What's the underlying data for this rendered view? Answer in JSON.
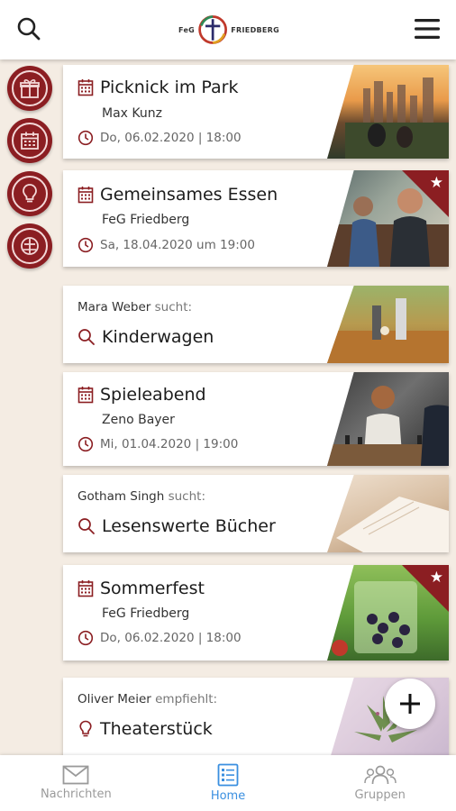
{
  "header": {
    "logo_left": "FeG",
    "logo_right": "FRIEDBERG",
    "search_icon": "search-icon",
    "menu_icon": "hamburger-menu-icon"
  },
  "sidebar": {
    "items": [
      {
        "icon": "gift-icon"
      },
      {
        "icon": "calendar-icon"
      },
      {
        "icon": "lightbulb-icon"
      },
      {
        "icon": "church-icon"
      }
    ]
  },
  "feed": {
    "picnic": {
      "title": "Picknick im Park",
      "organizer": "Max Kunz",
      "date": "Do, 06.02.2020 | 18:00"
    },
    "dinner": {
      "title": "Gemeinsames Essen",
      "organizer": "FeG Friedberg",
      "date": "Sa, 18.04.2020 um 19:00"
    },
    "stroller": {
      "person": "Mara Weber",
      "verb": "sucht:",
      "title": "Kinderwagen"
    },
    "games": {
      "title": "Spieleabend",
      "organizer": "Zeno Bayer",
      "date": "Mi, 01.04.2020 | 19:00"
    },
    "books": {
      "person": "Gotham Singh",
      "verb": "sucht:",
      "title": "Lesenswerte Bücher"
    },
    "summer": {
      "title": "Sommerfest",
      "organizer": "FeG Friedberg",
      "date": "Do, 06.02.2020 | 18:00"
    },
    "theater": {
      "person": "Oliver Meier",
      "verb": "empfiehlt:",
      "title": "Theaterstück"
    }
  },
  "bottom_nav": {
    "messages": "Nachrichten",
    "home": "Home",
    "groups": "Gruppen",
    "active": "Home"
  },
  "colors": {
    "accent": "#8b1e22",
    "active_nav": "#3a8fe0",
    "background": "#f4ece3"
  }
}
